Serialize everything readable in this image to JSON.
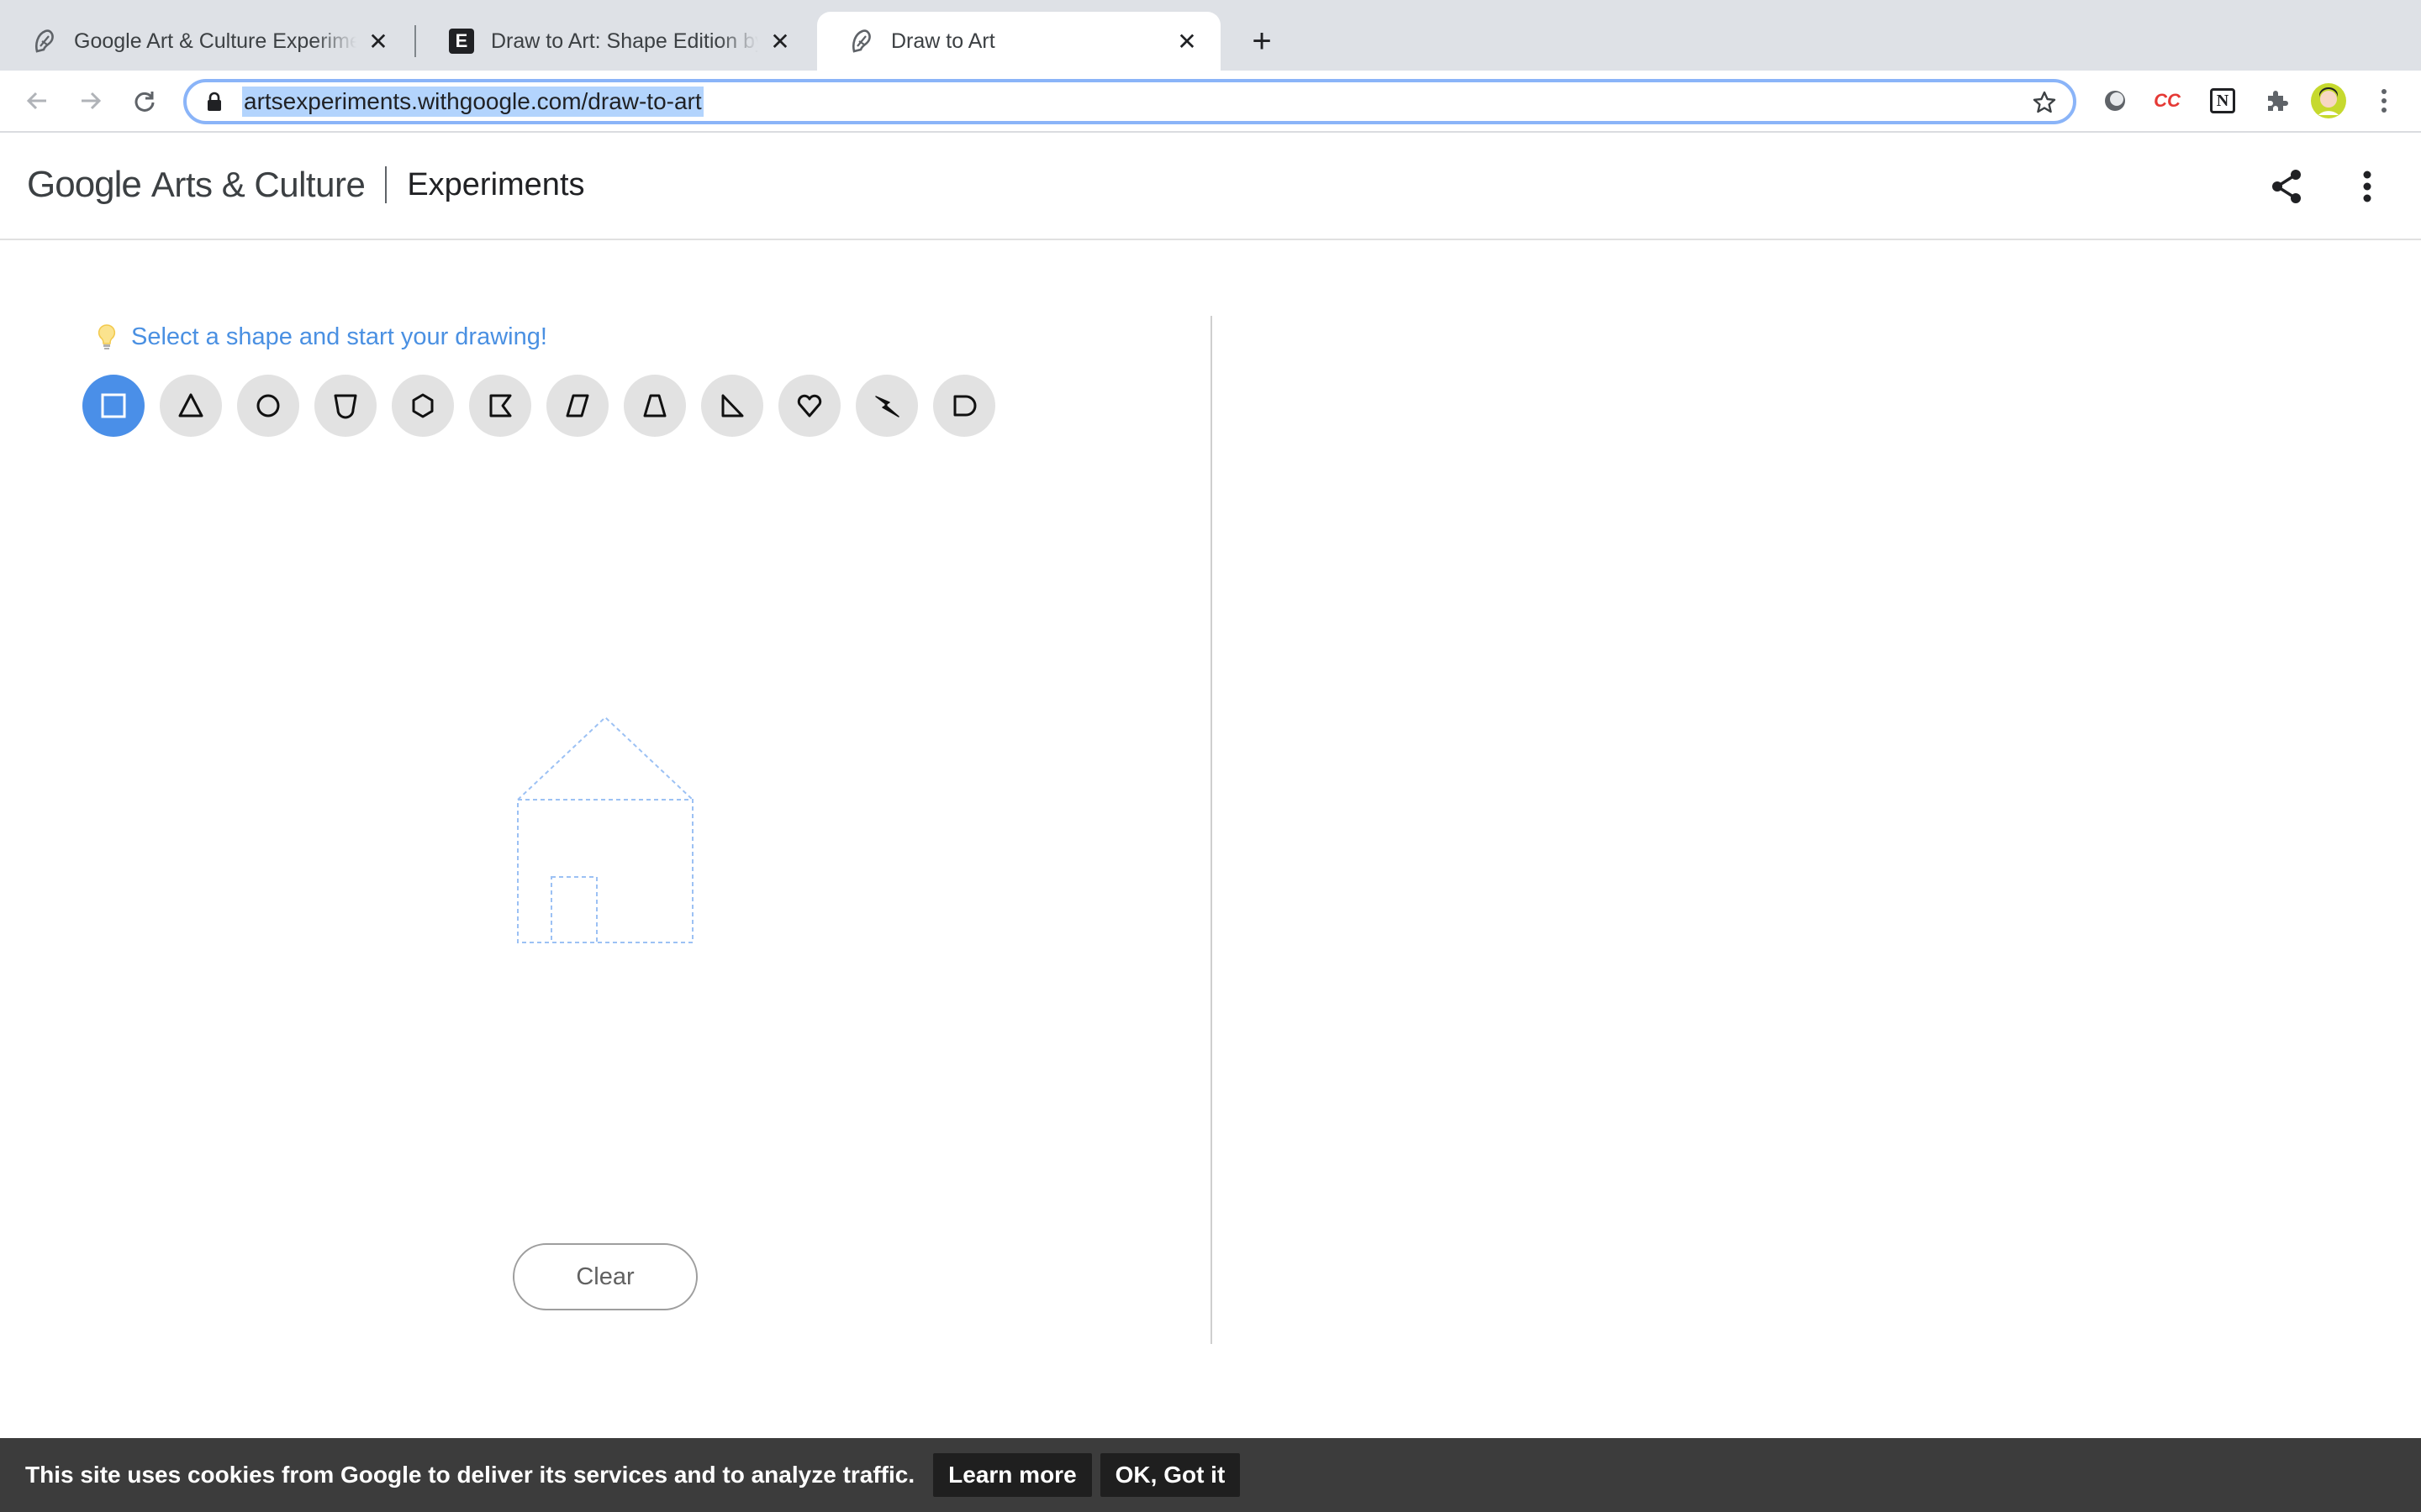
{
  "browser": {
    "tabs": [
      {
        "title": "Google Art & Culture Experiments",
        "favicon": "arts-culture-icon",
        "active": false
      },
      {
        "title": "Draw to Art: Shape Edition by Google Arts & Culture",
        "favicon": "e-letter-icon",
        "favicon_letter": "E",
        "active": false
      },
      {
        "title": "Draw to Art",
        "favicon": "arts-culture-icon",
        "active": true
      }
    ],
    "new_tab_label": "+",
    "url": "artsexperiments.withgoogle.com/draw-to-art",
    "extension_cc_label": "CC",
    "extension_notion_label": "N"
  },
  "header": {
    "google_label": "Google",
    "arts_culture_label": "Arts & Culture",
    "experiments_label": "Experiments"
  },
  "main": {
    "hint": "Select a shape and start your drawing!",
    "shapes": [
      {
        "name": "square",
        "selected": true
      },
      {
        "name": "triangle",
        "selected": false
      },
      {
        "name": "circle",
        "selected": false
      },
      {
        "name": "shield",
        "selected": false
      },
      {
        "name": "hexagon",
        "selected": false
      },
      {
        "name": "flag",
        "selected": false
      },
      {
        "name": "parallelogram",
        "selected": false
      },
      {
        "name": "trapezoid",
        "selected": false
      },
      {
        "name": "right-triangle",
        "selected": false
      },
      {
        "name": "heart",
        "selected": false
      },
      {
        "name": "lightning",
        "selected": false
      },
      {
        "name": "d-shape",
        "selected": false
      }
    ],
    "clear_label": "Clear"
  },
  "cookie": {
    "message": "This site uses cookies from Google to deliver its services and to analyze traffic.",
    "learn_more": "Learn more",
    "ok": "OK, Got it"
  },
  "colors": {
    "accent": "#4a8fe8",
    "hint": "#4a90e2",
    "guide": "#9cc1f4"
  }
}
